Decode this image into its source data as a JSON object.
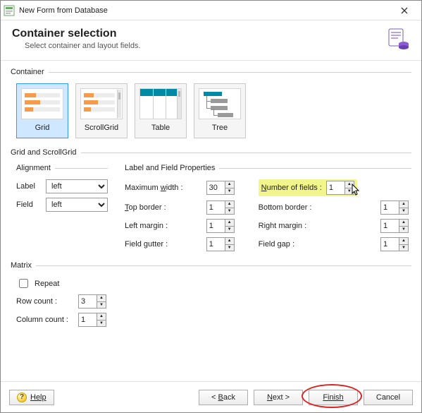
{
  "window": {
    "title": "New Form from Database"
  },
  "header": {
    "title": "Container selection",
    "subtitle": "Select container and layout fields."
  },
  "groups": {
    "container": "Container",
    "gridscroll": "Grid and ScrollGrid",
    "alignment": "Alignment",
    "lfprops": "Label and Field Properties",
    "matrix": "Matrix"
  },
  "containers": {
    "items": [
      {
        "label": "Grid",
        "selected": true
      },
      {
        "label": "ScrollGrid",
        "selected": false
      },
      {
        "label": "Table",
        "selected": false
      },
      {
        "label": "Tree",
        "selected": false
      }
    ]
  },
  "alignment": {
    "label_label": "Label",
    "field_label": "Field",
    "label_value": "left",
    "field_value": "left"
  },
  "props": {
    "max_width": {
      "label_pre": "Maximum ",
      "accel": "w",
      "label_post": "idth :",
      "value": "30"
    },
    "num_fields": {
      "label_pre": "",
      "accel": "N",
      "label_post": "umber of fields :",
      "value": "1"
    },
    "top_border": {
      "label_pre": "",
      "accel": "T",
      "label_post": "op border :",
      "value": "1"
    },
    "bottom_border": {
      "label": "Bottom border :",
      "value": "1"
    },
    "left_margin": {
      "label": "Left margin :",
      "value": "1"
    },
    "right_margin": {
      "label": "Right margin :",
      "value": "1"
    },
    "field_gutter": {
      "label": "Field gutter :",
      "value": "1"
    },
    "field_gap": {
      "label": "Field gap :",
      "value": "1"
    }
  },
  "matrix": {
    "repeat_label": "Repeat",
    "repeat_checked": false,
    "row_count_label": "Row count :",
    "row_count_value": "3",
    "col_count_label": "Column count :",
    "col_count_value": "1"
  },
  "footer": {
    "help": "Help",
    "back_pre": "< ",
    "back_accel": "B",
    "back_post": "ack",
    "next_pre": "",
    "next_accel": "N",
    "next_post": "ext >",
    "finish": "Finish",
    "cancel": "Cancel"
  }
}
